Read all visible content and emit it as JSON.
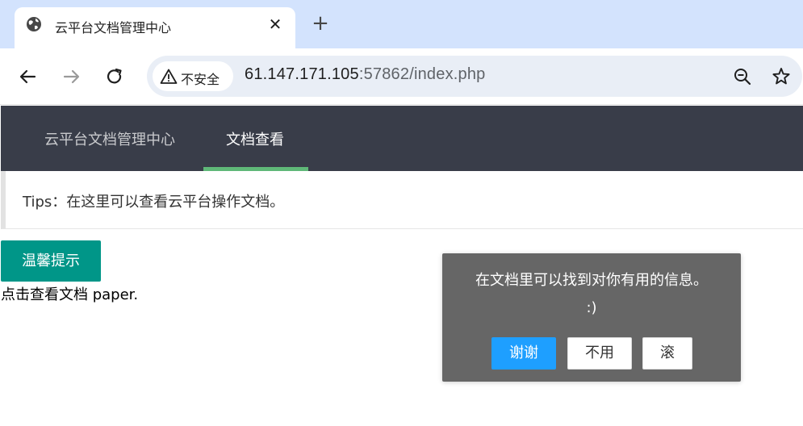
{
  "browser": {
    "tab_title": "云平台文档管理中心",
    "tab_close": "✕",
    "new_tab": "+",
    "security_label": "不安全",
    "url_host": "61.147.171.105",
    "url_rest": ":57862/index.php"
  },
  "navbar": {
    "logo": "云平台文档管理中心",
    "active_item": "文档查看",
    "indicator_color": "#5fb878"
  },
  "tips": {
    "text": "Tips：在这里可以查看云平台操作文档。"
  },
  "content": {
    "warm_button": "温馨提示",
    "paper_text": "点击查看文档 paper."
  },
  "dialog": {
    "message_line1": "在文档里可以找到对你有用的信息。",
    "message_line2": ":)",
    "btn_thanks": "谢谢",
    "btn_no": "不用",
    "btn_go": "滚"
  },
  "colors": {
    "tabstrip": "#d3e3fd",
    "navbar_bg": "#393d49",
    "warm_button": "#009688",
    "dialog_bg": "#666666",
    "primary_button": "#1e9fff"
  },
  "icons": {
    "favicon": "globe-icon",
    "back": "arrow-left-icon",
    "forward": "arrow-right-icon",
    "reload": "reload-icon",
    "security": "warning-triangle-icon",
    "zoom": "zoom-out-icon",
    "bookmark": "star-icon"
  }
}
